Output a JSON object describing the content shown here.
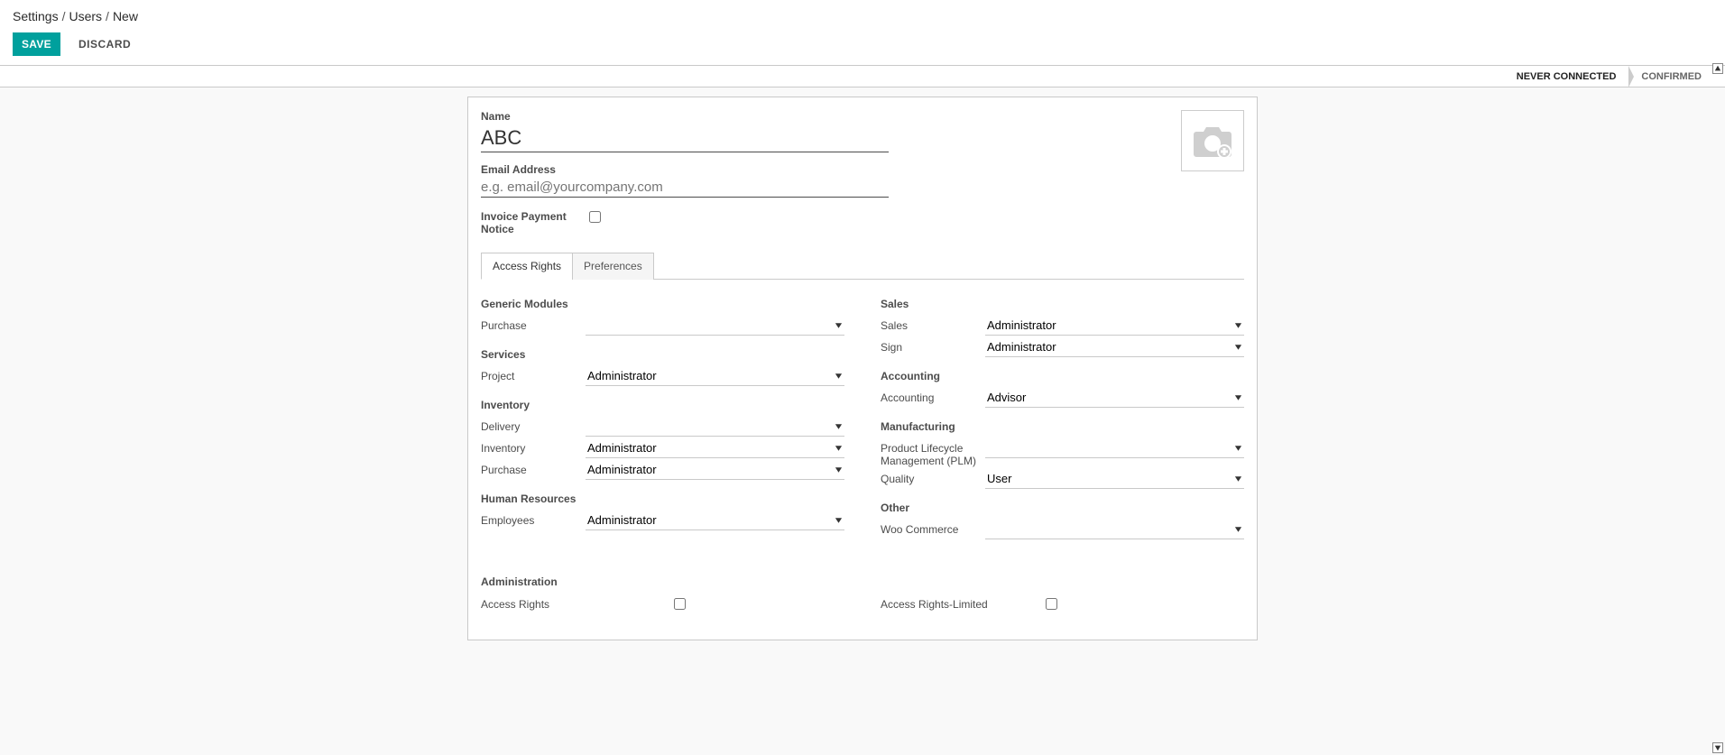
{
  "breadcrumb": {
    "settings": "Settings",
    "users": "Users",
    "new": "New"
  },
  "actions": {
    "save": "SAVE",
    "discard": "DISCARD"
  },
  "status": {
    "never_connected": "NEVER CONNECTED",
    "confirmed": "CONFIRMED"
  },
  "form": {
    "name_label": "Name",
    "name_value": "ABC",
    "email_label": "Email Address",
    "email_placeholder": "e.g. email@yourcompany.com",
    "email_value": "",
    "invoice_payment_notice_label": "Invoice Payment Notice",
    "invoice_payment_notice_checked": false
  },
  "tabs": {
    "access_rights": "Access Rights",
    "preferences": "Preferences",
    "active": "access_rights"
  },
  "groups_left": [
    {
      "title": "Generic Modules",
      "rows": [
        {
          "label": "Purchase",
          "value": ""
        }
      ]
    },
    {
      "title": "Services",
      "rows": [
        {
          "label": "Project",
          "value": "Administrator"
        }
      ]
    },
    {
      "title": "Inventory",
      "rows": [
        {
          "label": "Delivery",
          "value": ""
        },
        {
          "label": "Inventory",
          "value": "Administrator"
        },
        {
          "label": "Purchase",
          "value": "Administrator"
        }
      ]
    },
    {
      "title": "Human Resources",
      "rows": [
        {
          "label": "Employees",
          "value": "Administrator"
        }
      ]
    }
  ],
  "groups_right": [
    {
      "title": "Sales",
      "rows": [
        {
          "label": "Sales",
          "value": "Administrator"
        },
        {
          "label": "Sign",
          "value": "Administrator"
        }
      ]
    },
    {
      "title": "Accounting",
      "rows": [
        {
          "label": "Accounting",
          "value": "Advisor"
        }
      ]
    },
    {
      "title": "Manufacturing",
      "rows": [
        {
          "label": "Product Lifecycle Management (PLM)",
          "value": ""
        },
        {
          "label": "Quality",
          "value": "User"
        }
      ]
    },
    {
      "title": "Other",
      "rows": [
        {
          "label": "Woo Commerce",
          "value": ""
        }
      ]
    }
  ],
  "administration": {
    "title": "Administration",
    "access_rights_label": "Access Rights",
    "access_rights_checked": false,
    "access_rights_limited_label": "Access Rights-Limited",
    "access_rights_limited_checked": false
  }
}
